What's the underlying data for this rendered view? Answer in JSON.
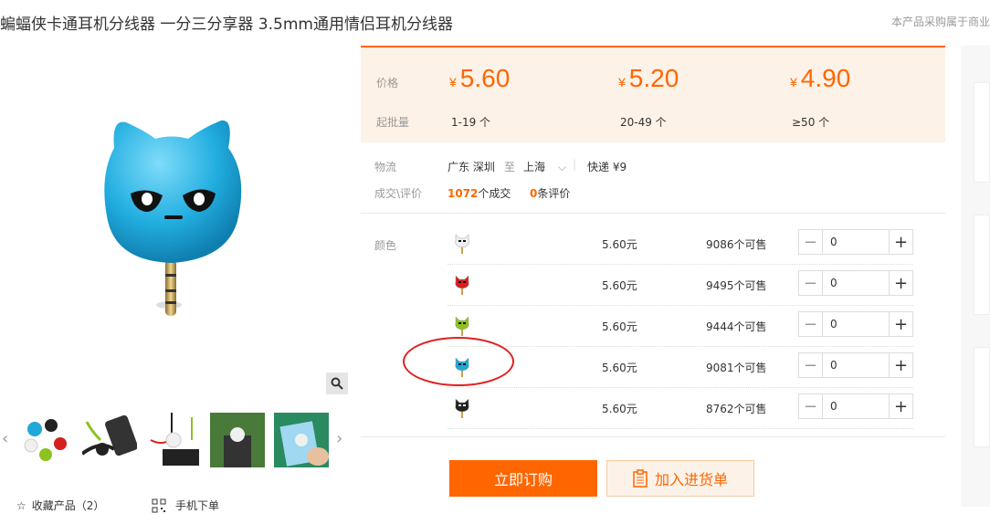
{
  "title": "蝙蝠侠卡通耳机分线器 一分三分享器 3.5mm通用情侣耳机分线器",
  "notice": "本产品采购属于商业",
  "price_box": {
    "price_label": "价格",
    "moq_label": "起批量",
    "currency": "¥",
    "tiers": [
      {
        "price": "5.60",
        "qty": "1-19 个"
      },
      {
        "price": "5.20",
        "qty": "20-49 个"
      },
      {
        "price": "4.90",
        "qty": "≥50 个"
      }
    ]
  },
  "logistics": {
    "label": "物流",
    "from": "广东 深圳",
    "to_word": "至",
    "to": "上海",
    "shipping": "快递 ¥9",
    "deal_label": "成交\\评价",
    "deals": "1072",
    "deals_suffix": "个成交",
    "reviews": "0",
    "reviews_suffix": "条评价"
  },
  "sku": {
    "label": "颜色",
    "rows": [
      {
        "icon": "white-cat-icon",
        "color": "#f0f0f0",
        "price": "5.60元",
        "stock": "9086个可售",
        "qty": "0"
      },
      {
        "icon": "red-cat-icon",
        "color": "#d62020",
        "price": "5.60元",
        "stock": "9495个可售",
        "qty": "0"
      },
      {
        "icon": "green-cat-icon",
        "color": "#8dc21f",
        "price": "5.60元",
        "stock": "9444个可售",
        "qty": "0"
      },
      {
        "icon": "blue-cat-icon",
        "color": "#1fa8d8",
        "price": "5.60元",
        "stock": "9081个可售",
        "qty": "0"
      },
      {
        "icon": "black-cat-icon",
        "color": "#222222",
        "price": "5.60元",
        "stock": "8762个可售",
        "qty": "0"
      }
    ]
  },
  "actions": {
    "order": "立即订购",
    "cart": "加入进货单"
  },
  "footer": {
    "favorite": "收藏产品（2）",
    "mobile": "手机下单"
  },
  "colors": {
    "accent": "#ff6600",
    "price_bg": "#fdf2e7",
    "highlight_circle": "#e02020"
  }
}
